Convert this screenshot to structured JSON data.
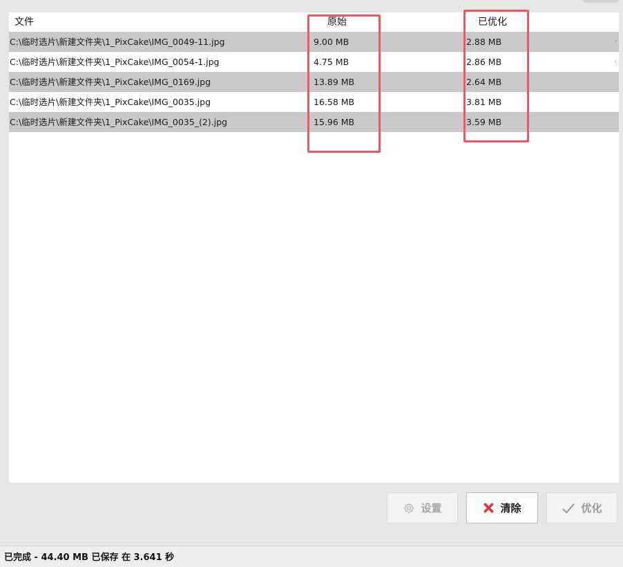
{
  "columns": {
    "file": "文件",
    "original": "原始",
    "optimized": "已优化"
  },
  "rows": [
    {
      "file": "C:\\临时选片\\新建文件夹\\1_PixCake\\IMG_0049-11.jpg",
      "original": "9.00 MB",
      "optimized": "2.88 MB"
    },
    {
      "file": "C:\\临时选片\\新建文件夹\\1_PixCake\\IMG_0054-1.jpg",
      "original": "4.75 MB",
      "optimized": "2.86 MB"
    },
    {
      "file": "C:\\临时选片\\新建文件夹\\1_PixCake\\IMG_0169.jpg",
      "original": "13.89 MB",
      "optimized": "2.64 MB"
    },
    {
      "file": "C:\\临时选片\\新建文件夹\\1_PixCake\\IMG_0035.jpg",
      "original": "16.58 MB",
      "optimized": "3.81 MB"
    },
    {
      "file": "C:\\临时选片\\新建文件夹\\1_PixCake\\IMG_0035_(2).jpg",
      "original": "15.96 MB",
      "optimized": "3.59 MB"
    }
  ],
  "buttons": {
    "settings": {
      "label": "设置",
      "icon": "gear-icon",
      "enabled": false
    },
    "clear": {
      "label": "清除",
      "icon": "red-x-icon",
      "enabled": true
    },
    "optimize": {
      "label": "优化",
      "icon": "checkmark-icon",
      "enabled": false
    }
  },
  "status": {
    "text": "已完成 - 44.40 MB 已保存 在 3.641 秒"
  },
  "colors": {
    "highlight": "#e85a5e",
    "alt_row": "#c9c9c9",
    "clear_icon": "#d9363e"
  }
}
